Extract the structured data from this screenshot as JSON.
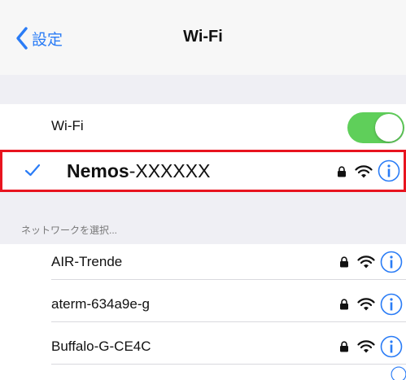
{
  "navbar": {
    "back_label": "設定",
    "title": "Wi-Fi"
  },
  "wifi_toggle": {
    "label": "Wi-Fi",
    "on": true
  },
  "connected_network": {
    "name_bold": "Nemos",
    "name_rest": "-XXXXXX"
  },
  "networks_section": {
    "header": "ネットワークを選択..."
  },
  "networks": [
    {
      "name": "AIR-Trende"
    },
    {
      "name": "aterm-634a9e-g"
    },
    {
      "name": "Buffalo-G-CE4C"
    }
  ],
  "colors": {
    "accent": "#2a7cf6",
    "toggle_on": "#5fcf5a",
    "highlight_border": "#e8141f",
    "group_background": "#efeff4"
  },
  "icons": {
    "back": "chevron-left-icon",
    "check": "checkmark-icon",
    "lock": "lock-icon",
    "wifi": "wifi-signal-icon",
    "info": "info-icon"
  }
}
